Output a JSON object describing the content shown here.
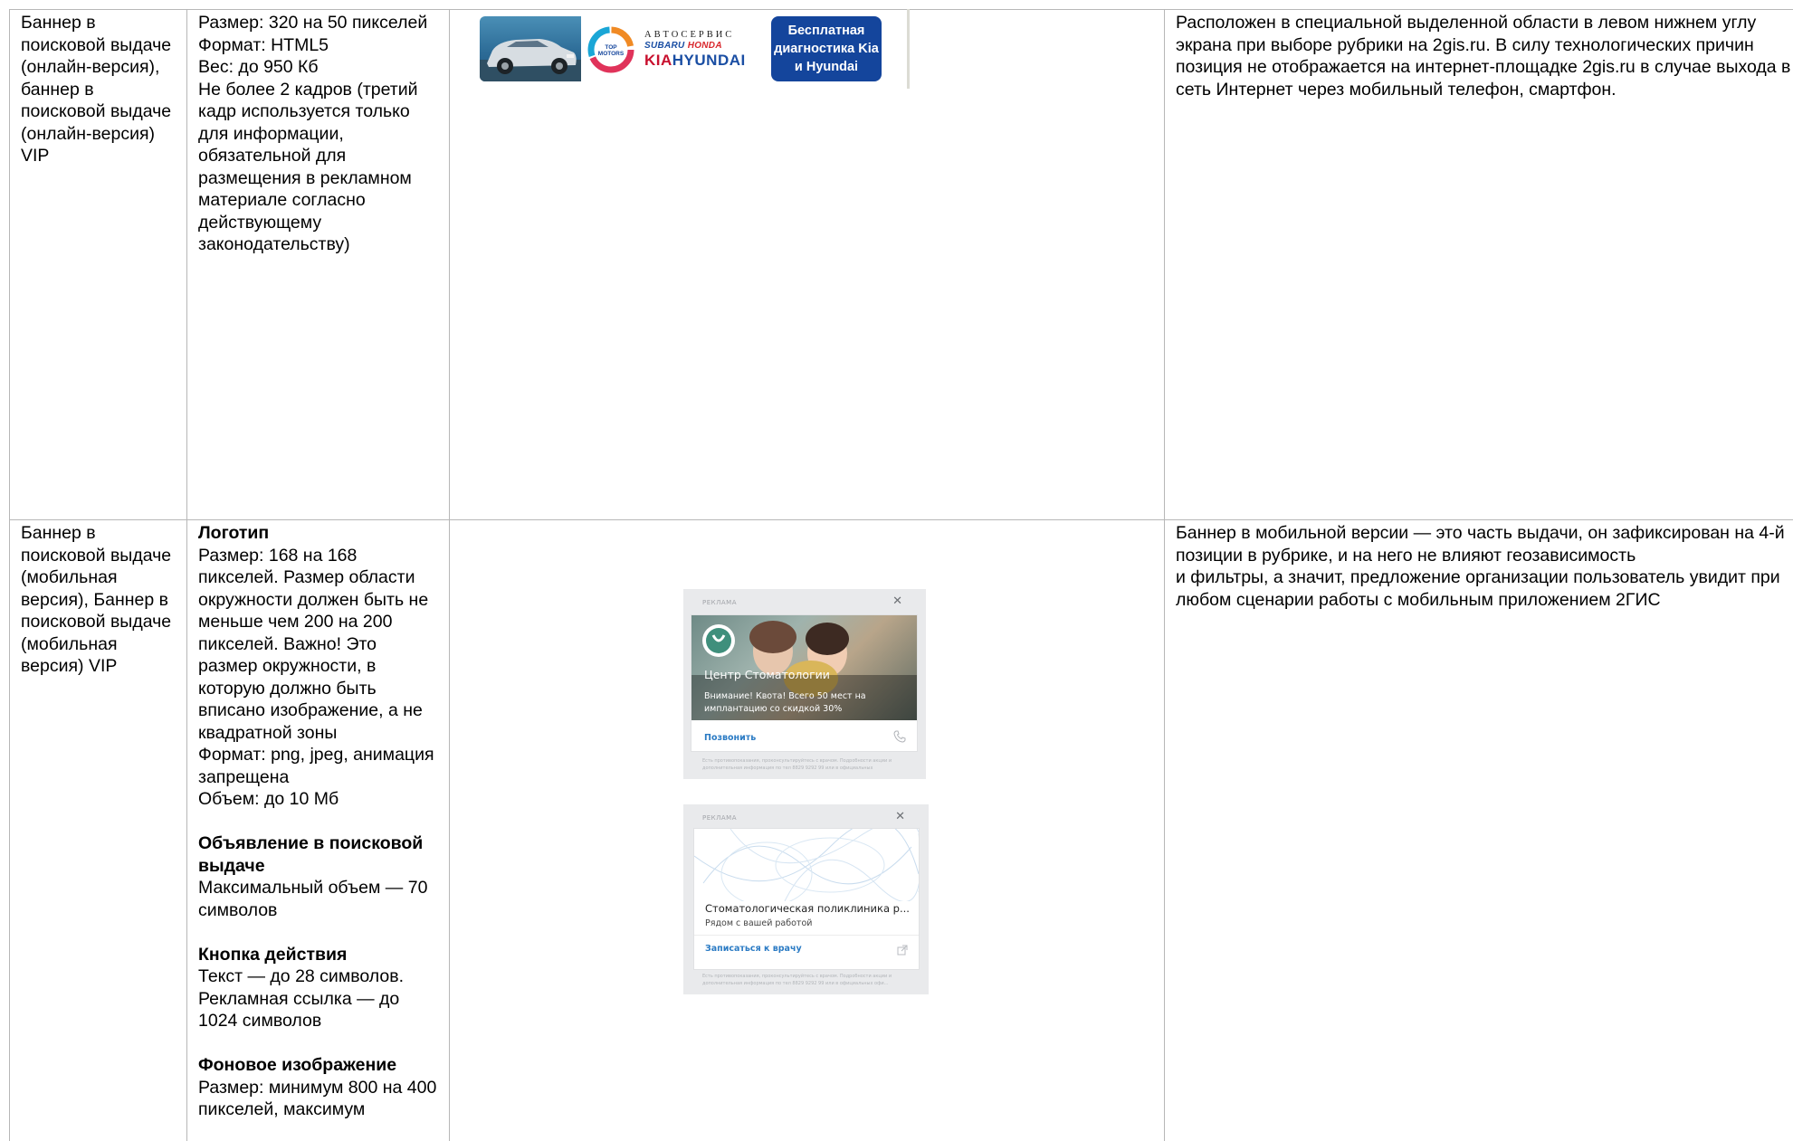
{
  "rows": [
    {
      "name": "Баннер в поисковой выдаче (онлайн-версия), баннер в поисковой выдаче (онлайн-версия)  VIP",
      "requirements": "Размер: 320 на 50 пикселей\nФормат: HTML5\nВес: до 950 Кб\nНе более 2 кадров (третий кадр используется только для информации, обязательной для размещения в рекламном материале согласно действующему законодательству)",
      "description": "Расположен в специальной выделенной области в левом нижнем углу экрана при выборе рубрики на 2gis.ru. В силу технологических причин позиция не отображается на интернет-площадке 2gis.ru в случае выхода в сеть Интернет через мобильный телефон, смартфон.",
      "banner": {
        "top_motors": "TOP MOTORS",
        "autoservice": "АВТОСЕРВИС",
        "subaru": "SUBARU",
        "honda": "HONDA",
        "kia": "KIA",
        "hyundai": "HYUNDAI",
        "promo": "Бесплатная диагностика Kia и Hyundai"
      }
    },
    {
      "name": "Баннер в поисковой выдаче (мобильная версия), Баннер в поисковой выдаче (мобильная версия) VIP",
      "requirements": {
        "logo_heading": "Логотип",
        "logo_text": "Размер: 168 на 168 пикселей. Размер области окружности должен быть не меньше чем 200 на 200 пикселей. Важно! Это размер окружности, в которую должно быть вписано изображение, а не квадратной зоны\nФормат: png, jpeg, анимация запрещена\nОбъем: до 10 Мб",
        "ad_heading": "Объявление в поисковой выдаче",
        "ad_text": "Максимальный объем — 70 символов",
        "button_heading": "Кнопка действия",
        "button_text": "Текст — до 28 символов.\nРекламная ссылка — до 1024 символов",
        "bg_heading": "Фоновое изображение",
        "bg_text": "Размер: минимум 800 на 400 пикселей, максимум"
      },
      "description": "Баннер в мобильной версии — это часть выдачи, он зафиксирован на 4-й позиции в рубрике, и на него не влияют геозависимость\nи фильтры, а значит, предложение организации пользователь увидит при любом сценарии работы с мобильным приложением 2ГИС",
      "mobile_ads": [
        {
          "tag": "РЕКЛАМА",
          "title": "Центр Стоматологии",
          "text": "Внимание! Квота! Всего 50 мест на имплантацию со скидкой 30%",
          "action": "Позвонить",
          "action_icon": "phone-icon",
          "fine_print": "Есть противопоказания, проконсультируйтесь с врачом. Подробности акции и дополнительная информация по тел 8829 9292 99 или в официальных"
        },
        {
          "tag": "РЕКЛАМА",
          "title": "Стоматологическая поликлиника р...",
          "subtitle": "Рядом с вашей работой",
          "action": "Записаться к врачу",
          "action_icon": "external-link-icon",
          "fine_print": "Есть противопоказания, проконсультируйтесь с врачом. Подробности акции и дополнительная информация по тел 8829 9292 99 или в официальных офи..."
        }
      ]
    }
  ],
  "colors": {
    "border": "#b7b7b7",
    "promo_bg": "#14459c",
    "kia": "#c8102e",
    "hyundai": "#1a4ea3",
    "link_blue": "#2b7bc4"
  }
}
